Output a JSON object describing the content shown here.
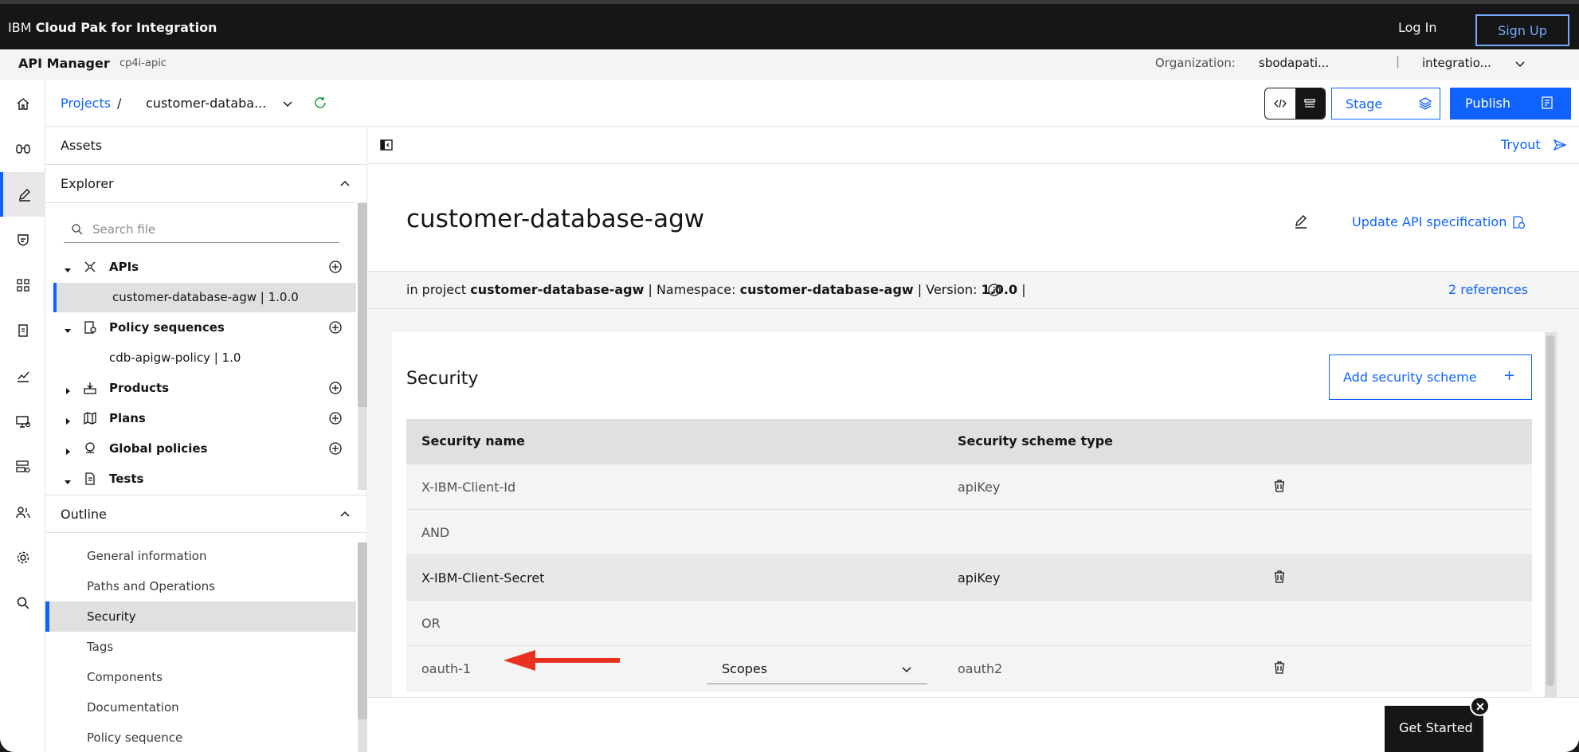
{
  "topbar": {
    "brand_prefix": "IBM",
    "brand_name": "Cloud Pak for Integration",
    "login_label": "Log In",
    "signup_label": "Sign Up"
  },
  "subbar": {
    "app_title": "API Manager",
    "instance": "cp4i-apic",
    "org_label": "Organization:",
    "org_value": "sbodapati...",
    "separator": "|",
    "catalog_value": "integratio..."
  },
  "rail": {
    "icons": [
      "home-icon",
      "binoculars-icon",
      "edit-icon",
      "shield-icon",
      "apps-icon",
      "document-icon",
      "analytics-icon",
      "monitor-icon",
      "servers-icon",
      "users-icon",
      "settings-icon",
      "search-icon"
    ]
  },
  "toolbar": {
    "crumb_projects": "Projects",
    "crumb_sep": "/",
    "crumb_current": "customer-databa...",
    "stage_label": "Stage",
    "publish_label": "Publish"
  },
  "sidebar": {
    "assets_label": "Assets",
    "explorer_label": "Explorer",
    "search_placeholder": "Search file",
    "tree": [
      {
        "label": "APIs",
        "icon": "api-icon",
        "expanded": true
      },
      {
        "label": "Policy sequences",
        "icon": "policy-icon",
        "expanded": true
      },
      {
        "label": "Products",
        "icon": "product-icon",
        "expanded": false
      },
      {
        "label": "Plans",
        "icon": "map-icon",
        "expanded": false
      },
      {
        "label": "Global policies",
        "icon": "globe-icon",
        "expanded": false
      },
      {
        "label": "Tests",
        "icon": "test-icon",
        "expanded": true
      }
    ],
    "api_leaf": "customer-database-agw | 1.0.0",
    "policy_leaf": "cdb-apigw-policy | 1.0",
    "outline_label": "Outline",
    "outline_items": [
      "General information",
      "Paths and Operations",
      "Security",
      "Tags",
      "Components",
      "Documentation",
      "Policy sequence"
    ],
    "outline_selected": "Security"
  },
  "main": {
    "tryout_label": "Tryout",
    "api_title": "customer-database-agw",
    "update_spec_label": "Update API specification",
    "info": {
      "project_prefix": "in project",
      "project_name": "customer-database-agw",
      "namespace_prefix": "| Namespace:",
      "namespace": "customer-database-agw",
      "version_prefix": "| Version:",
      "version": "1.0.0",
      "suffix": "|"
    },
    "references_label": "2 references",
    "security": {
      "title": "Security",
      "add_button": "Add security scheme",
      "add_plus": "+",
      "headers": {
        "name": "Security name",
        "type": "Security scheme type"
      },
      "rows": [
        {
          "name": "X-IBM-Client-Id",
          "type": "apiKey"
        },
        {
          "joiner": "AND"
        },
        {
          "name": "X-IBM-Client-Secret",
          "type": "apiKey"
        },
        {
          "joiner": "OR"
        },
        {
          "name": "oauth-1",
          "scopes": "Scopes",
          "type": "oauth2"
        }
      ]
    }
  },
  "get_started_label": "Get Started",
  "colors": {
    "accent": "#0f62fe",
    "dark": "#161616",
    "arrow": "#e8321f"
  }
}
